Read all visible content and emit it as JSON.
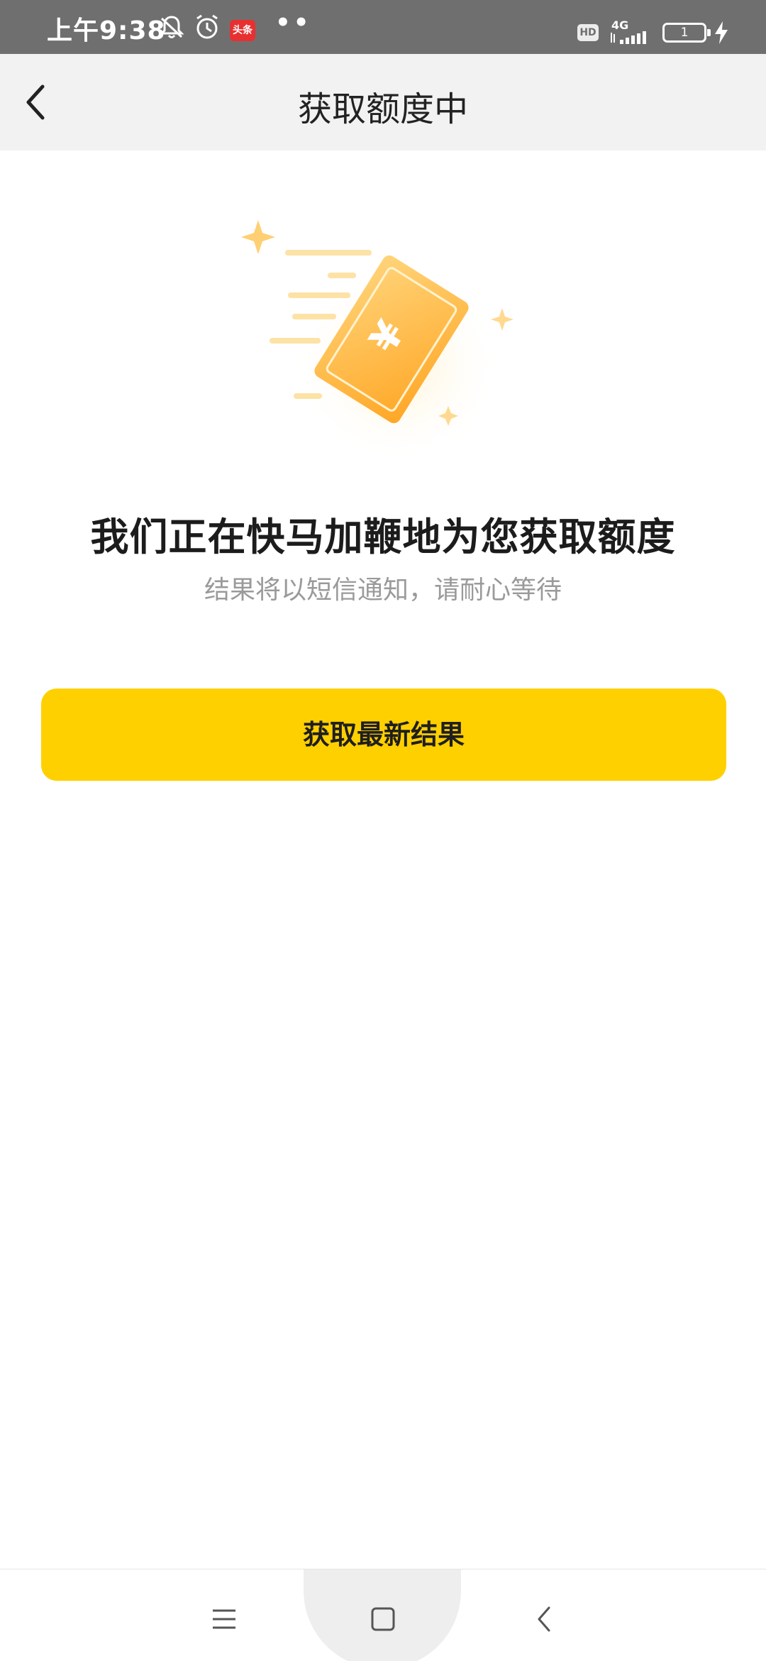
{
  "status_bar": {
    "time": "上午9:38",
    "news_badge": "头条",
    "dots": "••",
    "hd_label": "HD",
    "network_label": "4G",
    "battery_level": "1",
    "icons": [
      "mute-bell-icon",
      "alarm-icon",
      "toutiao-app-icon",
      "hd-icon",
      "signal-icon",
      "battery-icon",
      "charging-icon"
    ]
  },
  "header": {
    "title": "获取额度中",
    "back_icon": "chevron-left-icon"
  },
  "illustration": {
    "icon": "money-card-icon",
    "card_symbol": "¥",
    "colors": {
      "card": "#ffb53a",
      "card_light": "#ffd27a",
      "sparkle": "#ffcf73"
    }
  },
  "main": {
    "headline": "我们正在快马加鞭地为您获取额度",
    "subtext": "结果将以短信通知，请耐心等待",
    "button_label": "获取最新结果",
    "button_color": "#ffd000"
  },
  "nav_bar": {
    "icons": [
      "menu-icon",
      "home-square-icon",
      "back-triangle-icon"
    ]
  }
}
